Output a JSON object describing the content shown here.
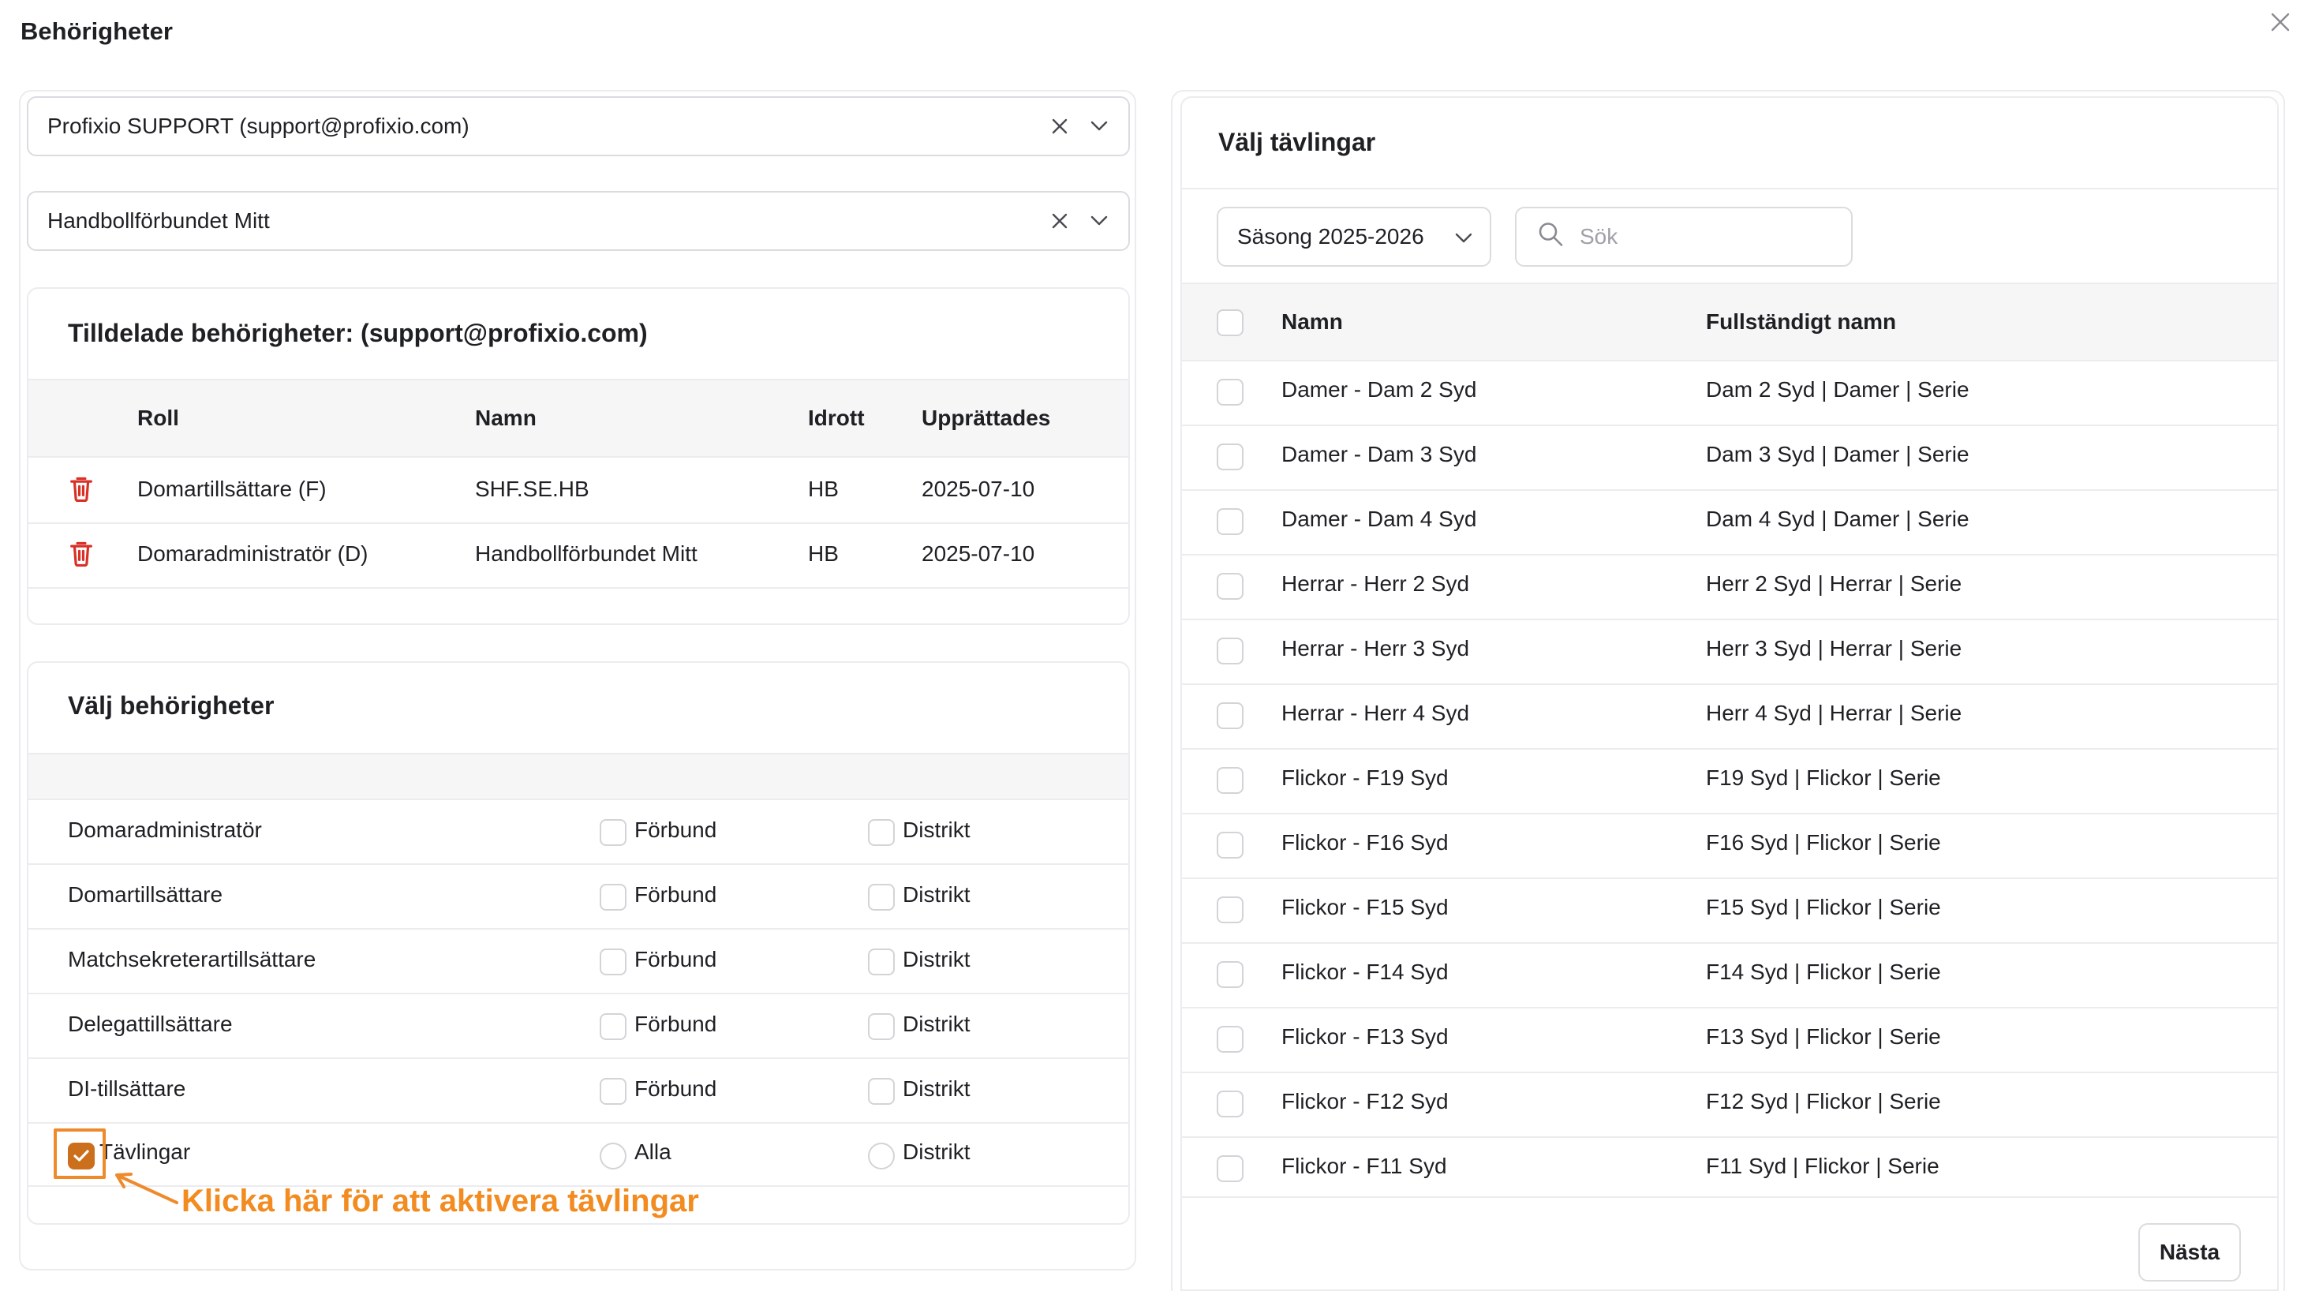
{
  "modal": {
    "title": "Behörigheter"
  },
  "left": {
    "user_select": {
      "value": "Profixio SUPPORT (support@profixio.com)"
    },
    "org_select": {
      "value": "Handbollförbundet Mitt"
    },
    "assigned": {
      "title": "Tilldelade behörigheter: (support@profixio.com)",
      "columns": {
        "role": "Roll",
        "name": "Namn",
        "sport": "Idrott",
        "created": "Upprättades"
      },
      "rows": [
        {
          "role": "Domartillsättare (F)",
          "name": "SHF.SE.HB",
          "sport": "HB",
          "created": "2025-07-10"
        },
        {
          "role": "Domaradministratör (D)",
          "name": "Handbollförbundet Mitt",
          "sport": "HB",
          "created": "2025-07-10"
        }
      ]
    },
    "select_permissions": {
      "title": "Välj behörigheter",
      "rows": [
        {
          "label": "Domaradministratör",
          "opt1": "Förbund",
          "opt2": "Distrikt"
        },
        {
          "label": "Domartillsättare",
          "opt1": "Förbund",
          "opt2": "Distrikt"
        },
        {
          "label": "Matchsekreterartillsättare",
          "opt1": "Förbund",
          "opt2": "Distrikt"
        },
        {
          "label": "Delegattillsättare",
          "opt1": "Förbund",
          "opt2": "Distrikt"
        },
        {
          "label": "DI-tillsättare",
          "opt1": "Förbund",
          "opt2": "Distrikt"
        }
      ],
      "competitions": {
        "label": "Tävlingar",
        "opt1": "Alla",
        "opt2": "Distrikt",
        "checked": true
      }
    },
    "annotation": "Klicka här för att aktivera tävlingar"
  },
  "right": {
    "title": "Välj tävlingar",
    "season": "Säsong 2025-2026",
    "search_placeholder": "Sök",
    "columns": {
      "name": "Namn",
      "fullname": "Fullständigt namn"
    },
    "rows": [
      {
        "name": "Damer - Dam 2 Syd",
        "fullname": "Dam 2 Syd | Damer | Serie"
      },
      {
        "name": "Damer - Dam 3 Syd",
        "fullname": "Dam 3 Syd | Damer | Serie"
      },
      {
        "name": "Damer - Dam 4 Syd",
        "fullname": "Dam 4 Syd | Damer | Serie"
      },
      {
        "name": "Herrar - Herr 2 Syd",
        "fullname": "Herr 2 Syd | Herrar | Serie"
      },
      {
        "name": "Herrar - Herr 3 Syd",
        "fullname": "Herr 3 Syd | Herrar | Serie"
      },
      {
        "name": "Herrar - Herr 4 Syd",
        "fullname": "Herr 4 Syd | Herrar | Serie"
      },
      {
        "name": "Flickor - F19 Syd",
        "fullname": "F19 Syd | Flickor | Serie"
      },
      {
        "name": "Flickor - F16 Syd",
        "fullname": "F16 Syd | Flickor | Serie"
      },
      {
        "name": "Flickor - F15 Syd",
        "fullname": "F15 Syd | Flickor | Serie"
      },
      {
        "name": "Flickor - F14 Syd",
        "fullname": "F14 Syd | Flickor | Serie"
      },
      {
        "name": "Flickor - F13 Syd",
        "fullname": "F13 Syd | Flickor | Serie"
      },
      {
        "name": "Flickor - F12 Syd",
        "fullname": "F12 Syd | Flickor | Serie"
      },
      {
        "name": "Flickor - F11 Syd",
        "fullname": "F11 Syd | Flickor | Serie"
      }
    ],
    "next_label": "Nästa"
  },
  "colors": {
    "accent": "#f28b20",
    "checked_fill": "#cc6f1d",
    "trash": "#d93025"
  }
}
